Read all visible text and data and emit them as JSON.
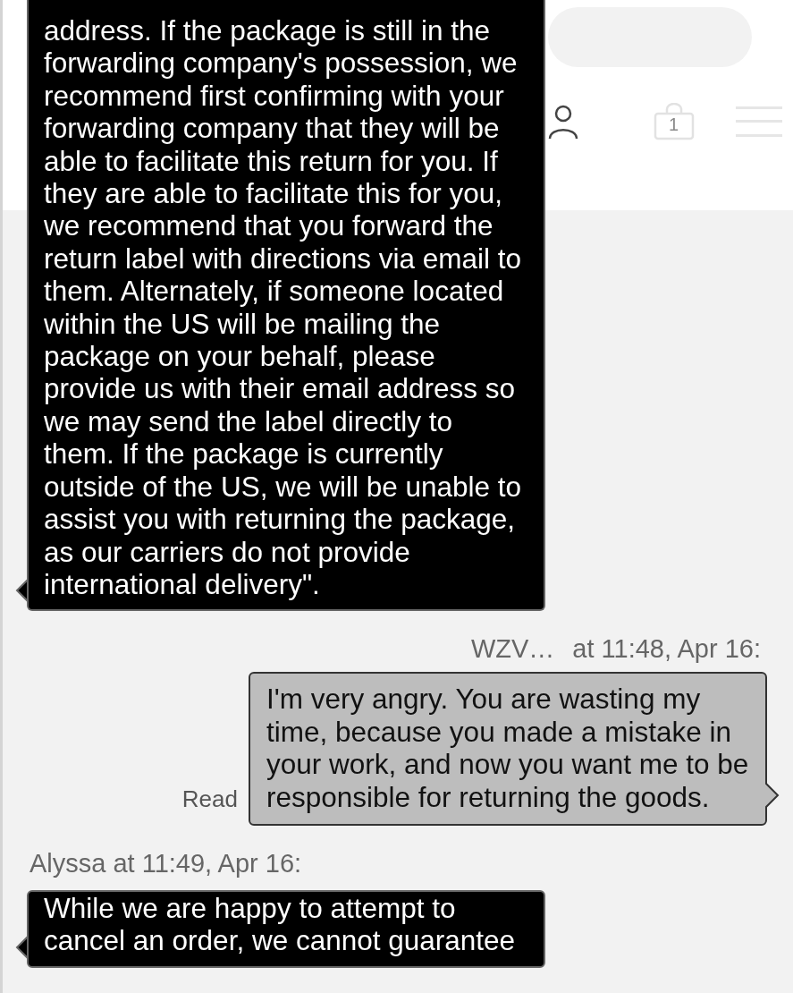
{
  "header": {
    "cart_count": "1"
  },
  "messages": [
    {
      "kind": "agent",
      "text": "address. If the package is still in the forwarding company's possession, we recommend first confirming with your forwarding company that they will be able to facilitate this return for you. If they are able to facilitate this for you, we recommend that you forward the return label with directions via email to them. Alternately, if someone located within the US will be mailing the package on your behalf, please provide us with their email address so we may send the label directly to them. If the package is currently outside of the US, we will be unable to assist you with returning the package, as our carriers do not provide international delivery\"."
    },
    {
      "kind": "customer",
      "sender": "WZV…",
      "time": "at 11:48, Apr 16:",
      "status": "Read",
      "text": "I'm very angry. You are wasting my time, because you made a mistake in your work, and now you want me to be responsible for returning the goods."
    },
    {
      "kind": "agent",
      "sender": "Alyssa",
      "time": "at 11:49, Apr 16:",
      "text": "While we are happy to attempt to cancel an order, we cannot guarantee"
    }
  ]
}
